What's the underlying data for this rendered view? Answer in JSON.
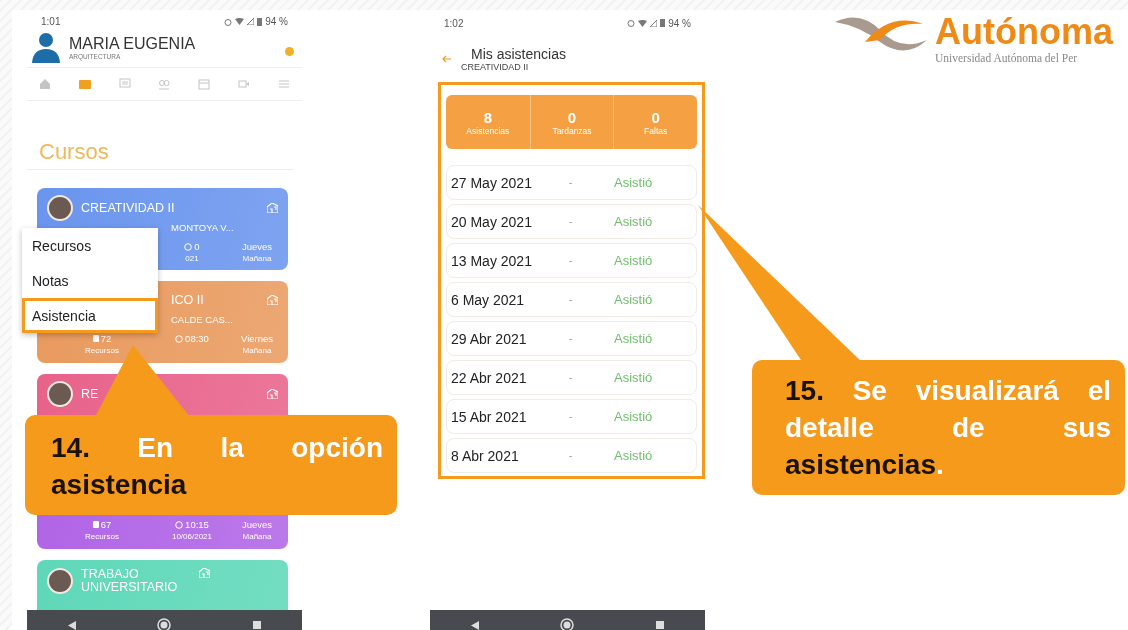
{
  "phone_1": {
    "status_bar": {
      "time": "1:01",
      "battery": "94 %"
    },
    "profile": {
      "name": "MARIA EUGENIA",
      "program": "ARQUITECTURA"
    },
    "nav_tabs": [
      {
        "selected": false
      },
      {
        "selected": true
      },
      {
        "selected": false
      },
      {
        "selected": false
      },
      {
        "selected": false
      },
      {
        "selected": false
      },
      {
        "selected": false
      }
    ],
    "heading": "Cursos",
    "courses": [
      {
        "color": "#6a95ee",
        "title": "CREATIVIDAD II",
        "subtitle": "MONTOYA V...",
        "stats": {
          "middle": {
            "value": "0",
            "label": "021"
          },
          "right": {
            "value": "Jueves",
            "label": "Mañana"
          }
        }
      },
      {
        "color": "#e99a5e",
        "title": "ICO II",
        "subtitle": "CALDE CAS...",
        "stats": {
          "left": {
            "value": "72",
            "label": "Recursos"
          },
          "middle": {
            "value": "08:30"
          },
          "right": {
            "value": "Viernes",
            "label": "Mañana"
          }
        }
      },
      {
        "color": "#e8628a",
        "title": "RE"
      },
      {
        "color": "#b064e6",
        "stats": {
          "left": {
            "value": "67",
            "label": "Recursos"
          },
          "middle": {
            "value": "10:15",
            "label": "10/06/2021"
          },
          "right": {
            "value": "Jueves",
            "label": "Mañana"
          }
        }
      },
      {
        "color": "#5ed8b8",
        "title": "TRABAJO UNIVERSITARIO"
      }
    ],
    "context_menu": [
      {
        "label": "Recursos",
        "selected": false
      },
      {
        "label": "Notas",
        "selected": false
      },
      {
        "label": "Asistencia",
        "selected": true
      }
    ]
  },
  "phone_2": {
    "status_bar": {
      "time": "1:02",
      "battery": "94 %"
    },
    "title": "Mis asistencias",
    "subtitle": "CREATIVIDAD II",
    "summary": [
      {
        "value": "8",
        "label": "Asistencias"
      },
      {
        "value": "0",
        "label": "Tardanzas"
      },
      {
        "value": "0",
        "label": "Faltas"
      }
    ],
    "rows": [
      {
        "date": "27 May 2021",
        "note": "-",
        "status": "Asistió"
      },
      {
        "date": "20 May 2021",
        "note": "-",
        "status": "Asistió"
      },
      {
        "date": "13 May 2021",
        "note": "-",
        "status": "Asistió"
      },
      {
        "date": "6 May 2021",
        "note": "-",
        "status": "Asistió"
      },
      {
        "date": "29 Abr 2021",
        "note": "-",
        "status": "Asistió"
      },
      {
        "date": "22 Abr 2021",
        "note": "-",
        "status": "Asistió"
      },
      {
        "date": "15 Abr 2021",
        "note": "-",
        "status": "Asistió"
      },
      {
        "date": "8 Abr 2021",
        "note": "-",
        "status": "Asistió"
      }
    ]
  },
  "logo": {
    "name": "Autónoma",
    "tagline": "Universidad Autónoma del Per"
  },
  "callouts": [
    {
      "parts": [
        {
          "text": "14.",
          "dark": true
        },
        {
          "text": " En la opción ",
          "dark": false
        },
        {
          "text": "asistencia",
          "dark": true
        }
      ]
    },
    {
      "parts": [
        {
          "text": "15.",
          "dark": true
        },
        {
          "text": " Se visualizará el detalle de sus ",
          "dark": false
        },
        {
          "text": "asistencias",
          "dark": true
        },
        {
          "text": ".",
          "dark": false
        }
      ]
    }
  ]
}
